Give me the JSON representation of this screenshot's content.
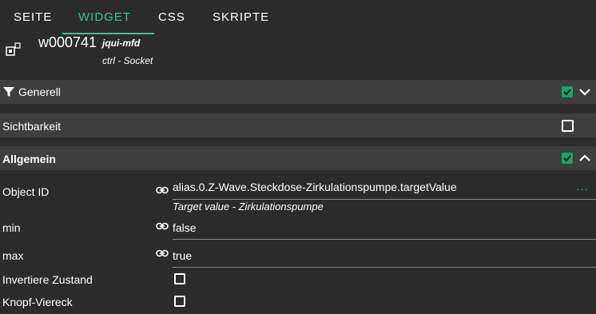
{
  "tabs": [
    {
      "label": "SEITE"
    },
    {
      "label": "WIDGET"
    },
    {
      "label": "CSS"
    },
    {
      "label": "SKRIPTE"
    }
  ],
  "active_tab": "WIDGET",
  "widget": {
    "id": "w000741",
    "set": "jqui-mfd",
    "type": "ctrl - Socket"
  },
  "sections": {
    "generell": {
      "title": "Generell",
      "checked": true,
      "expanded": false
    },
    "sichtbarkeit": {
      "title": "Sichtbarkeit",
      "checked": false
    },
    "allgemein": {
      "title": "Allgemein",
      "checked": true,
      "expanded": true
    }
  },
  "fields": {
    "object_id": {
      "label": "Object ID",
      "value": "alias.0.Z-Wave.Steckdose-Zirkulationspumpe.targetValue",
      "description": "Target value - Zirkulationspumpe",
      "more": "···"
    },
    "min": {
      "label": "min",
      "value": "false"
    },
    "max": {
      "label": "max",
      "value": "true"
    },
    "invert": {
      "label": "Invertiere Zustand",
      "checked": false
    },
    "square": {
      "label": "Knopf-Viereck",
      "checked": false
    }
  },
  "colors": {
    "accent": "#3ac48f",
    "checkbox": "#16a36e",
    "background": "#2b2b2b",
    "section_bg": "#3e3e3e"
  },
  "icons": [
    "widget-icon",
    "filter-icon",
    "chevron-down-icon",
    "chevron-up-icon",
    "link-icon",
    "check-icon"
  ]
}
